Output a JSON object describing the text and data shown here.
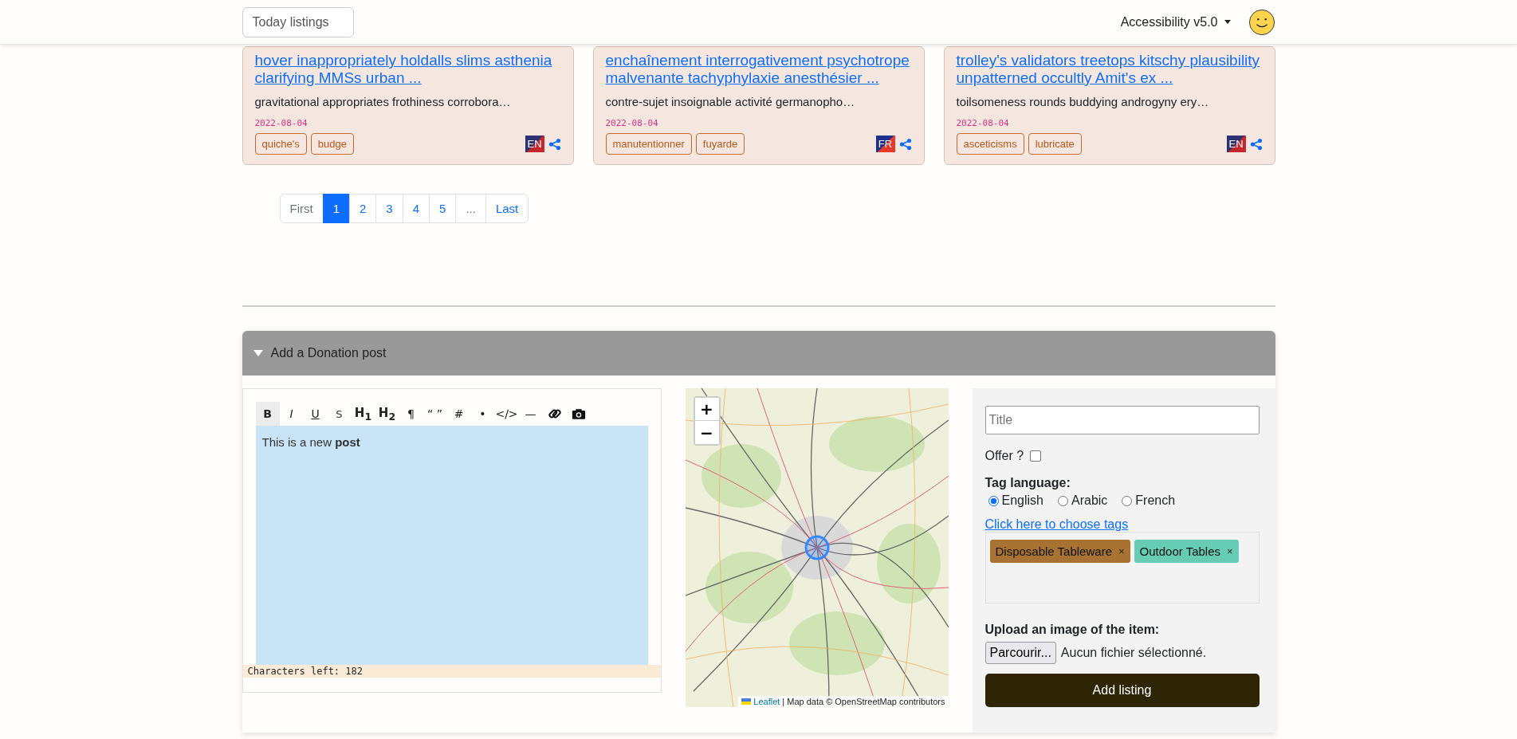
{
  "header": {
    "today_button": "Today listings",
    "accessibility_menu": "Accessibility v5.0"
  },
  "cards": [
    {
      "title": "hover inappropriately holdalls slims asthenia clarifying MMSs urban ...",
      "excerpt": "gravitational appropriates frothiness corrobora…",
      "date": "2022-08-04",
      "tags": [
        "quiche's",
        "budge"
      ],
      "language": {
        "label": "EN",
        "kind": "en"
      }
    },
    {
      "title": "enchaînement interrogativement psychotrope malvenante tachyphylaxie anesthésier ...",
      "excerpt": "contre-sujet insoignable activité germanopho…",
      "date": "2022-08-04",
      "tags": [
        "manutentionner",
        "fuyarde"
      ],
      "language": {
        "label": "FR",
        "kind": "fr"
      }
    },
    {
      "title": "trolley's validators treetops kitschy plausibility unpatterned occultly Amit's ex ...",
      "excerpt": "toilsomeness rounds buddying androgyny ery…",
      "date": "2022-08-04",
      "tags": [
        "asceticisms",
        "lubricate"
      ],
      "language": {
        "label": "EN",
        "kind": "en"
      }
    }
  ],
  "pagination": [
    {
      "label": "First",
      "selected": false,
      "disabled": true
    },
    {
      "label": "1",
      "selected": true,
      "disabled": false
    },
    {
      "label": "2",
      "selected": false,
      "disabled": false
    },
    {
      "label": "3",
      "selected": false,
      "disabled": false
    },
    {
      "label": "4",
      "selected": false,
      "disabled": false
    },
    {
      "label": "5",
      "selected": false,
      "disabled": false
    },
    {
      "label": "...",
      "selected": false,
      "disabled": true
    },
    {
      "label": "Last",
      "selected": false,
      "disabled": false
    }
  ],
  "donation_panel": {
    "title": "Add a Donation post",
    "expanded": true,
    "editor": {
      "toolbar": [
        {
          "kind": "bold",
          "label": "B",
          "selected": true
        },
        {
          "kind": "italic",
          "label": "I",
          "selected": false
        },
        {
          "kind": "underline",
          "label": "U",
          "selected": false
        },
        {
          "kind": "strike",
          "label": "S",
          "selected": false
        },
        {
          "kind": "heading",
          "label": "H$_{1}$",
          "selected": false
        },
        {
          "kind": "heading",
          "label": "H$_{2}$",
          "selected": false
        },
        {
          "kind": "plain",
          "label": "¶",
          "selected": false
        },
        {
          "kind": "plain",
          "label": "“ ”",
          "selected": false
        },
        {
          "kind": "plain",
          "label": "#",
          "selected": false
        },
        {
          "kind": "plain",
          "label": "•",
          "selected": false
        },
        {
          "kind": "plain",
          "label": "</>",
          "selected": false
        },
        {
          "kind": "plain",
          "label": "—",
          "selected": false
        },
        {
          "kind": "link",
          "selected": false
        },
        {
          "kind": "camera",
          "selected": false
        }
      ],
      "content": "This is a new **post**",
      "chars_left": "Characters left: 182"
    },
    "map": {
      "zoom_in": "+",
      "zoom_out": "−",
      "attribution_link": "Leaflet",
      "attribution": "| Map data © OpenStreetMap contributors"
    },
    "form": {
      "title_placeholder": "Title",
      "offer": {
        "label": "Offer ?",
        "checked": false
      },
      "tag_language_label": "Tag language:",
      "languages": [
        {
          "label": "English",
          "selected": true
        },
        {
          "label": "Arabic",
          "selected": false
        },
        {
          "label": "French",
          "selected": false
        }
      ],
      "choose_tags_link": "Click here to choose tags",
      "tags": [
        {
          "label": "Disposable Tableware",
          "remove": "×",
          "color": "#a87332"
        },
        {
          "label": "Outdoor Tables",
          "remove": "×",
          "color": "#66cdb4"
        }
      ],
      "upload_label": "Upload an image of the item:",
      "browse_button": "Parcourir...",
      "file_status": "Aucun fichier sélectionné.",
      "submit_button": "Add listing"
    }
  }
}
